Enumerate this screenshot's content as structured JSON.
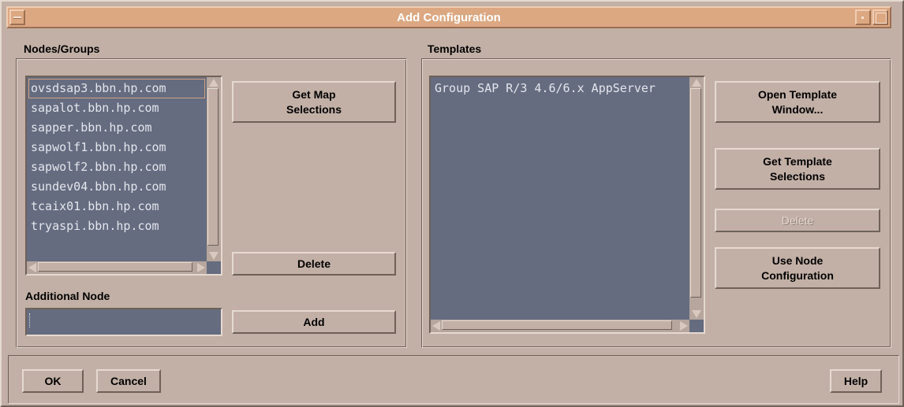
{
  "window": {
    "title": "Add Configuration"
  },
  "nodes_groups": {
    "label": "Nodes/Groups",
    "items": [
      "ovsdsap3.bbn.hp.com",
      "sapalot.bbn.hp.com",
      "sapper.bbn.hp.com",
      "sapwolf1.bbn.hp.com",
      "sapwolf2.bbn.hp.com",
      "sundev04.bbn.hp.com",
      "tcaix01.bbn.hp.com",
      "tryaspi.bbn.hp.com"
    ],
    "get_map_selections_label": "Get Map\nSelections",
    "delete_label": "Delete"
  },
  "additional_node": {
    "label": "Additional Node",
    "value": "",
    "add_label": "Add"
  },
  "templates": {
    "label": "Templates",
    "items": [
      "Group SAP R/3 4.6/6.x AppServer"
    ],
    "open_template_window_label": "Open Template\nWindow...",
    "get_template_selections_label": "Get Template\nSelections",
    "delete_label": "Delete",
    "use_node_configuration_label": "Use Node\nConfiguration"
  },
  "footer": {
    "ok_label": "OK",
    "cancel_label": "Cancel",
    "help_label": "Help"
  },
  "colors": {
    "background": "#c2b0a6",
    "title_bar": "#dca882",
    "list_background": "#656c80",
    "list_text": "#e4e6ec"
  }
}
